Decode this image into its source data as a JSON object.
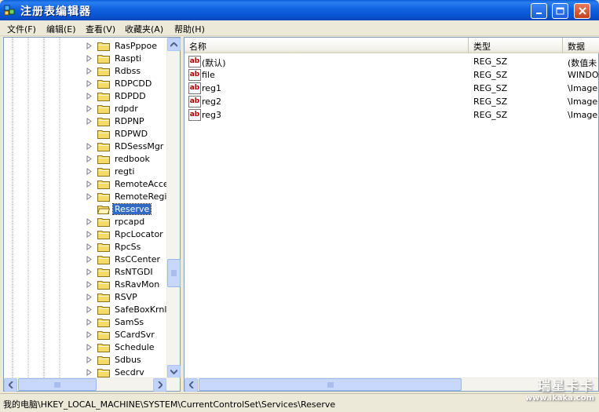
{
  "window": {
    "title": "注册表编辑器"
  },
  "menu": [
    "文件(F)",
    "编辑(E)",
    "查看(V)",
    "收藏夹(A)",
    "帮助(H)"
  ],
  "tree": {
    "items": [
      {
        "label": "RasPppoe",
        "expandable": true
      },
      {
        "label": "Raspti",
        "expandable": true
      },
      {
        "label": "Rdbss",
        "expandable": true
      },
      {
        "label": "RDPCDD",
        "expandable": true
      },
      {
        "label": "RDPDD",
        "expandable": true
      },
      {
        "label": "rdpdr",
        "expandable": true
      },
      {
        "label": "RDPNP",
        "expandable": true
      },
      {
        "label": "RDPWD",
        "expandable": false
      },
      {
        "label": "RDSessMgr",
        "expandable": true
      },
      {
        "label": "redbook",
        "expandable": true
      },
      {
        "label": "regti",
        "expandable": true
      },
      {
        "label": "RemoteAccess",
        "expandable": true
      },
      {
        "label": "RemoteRegist",
        "expandable": true
      },
      {
        "label": "Reserve",
        "expandable": false,
        "selected": true
      },
      {
        "label": "rpcapd",
        "expandable": true
      },
      {
        "label": "RpcLocator",
        "expandable": true
      },
      {
        "label": "RpcSs",
        "expandable": true
      },
      {
        "label": "RsCCenter",
        "expandable": true
      },
      {
        "label": "RsNTGDI",
        "expandable": true
      },
      {
        "label": "RsRavMon",
        "expandable": true
      },
      {
        "label": "RSVP",
        "expandable": true
      },
      {
        "label": "SafeBoxKrnl",
        "expandable": true
      },
      {
        "label": "SamSs",
        "expandable": true
      },
      {
        "label": "SCardSvr",
        "expandable": true
      },
      {
        "label": "Schedule",
        "expandable": true
      },
      {
        "label": "Sdbus",
        "expandable": true
      },
      {
        "label": "Secdrv",
        "expandable": true
      }
    ]
  },
  "list": {
    "columns": [
      "名称",
      "类型",
      "数据"
    ],
    "rows": [
      {
        "name": "(默认)",
        "type": "REG_SZ",
        "data": "(数值未"
      },
      {
        "name": "file",
        "type": "REG_SZ",
        "data": "WINDOW"
      },
      {
        "name": "reg1",
        "type": "REG_SZ",
        "data": "\\Image I"
      },
      {
        "name": "reg2",
        "type": "REG_SZ",
        "data": "\\Image I"
      },
      {
        "name": "reg3",
        "type": "REG_SZ",
        "data": "\\Image I"
      }
    ],
    "icon_text": "ab"
  },
  "status": {
    "path": "我的电脑\\HKEY_LOCAL_MACHINE\\SYSTEM\\CurrentControlSet\\Services\\Reserve"
  },
  "watermark": {
    "brand": "瑞星卡卡",
    "url": "www.ikaka.com"
  },
  "colors": {
    "titlebar": "#0a5fd8",
    "selection": "#316ac5",
    "border": "#7f9db9"
  }
}
